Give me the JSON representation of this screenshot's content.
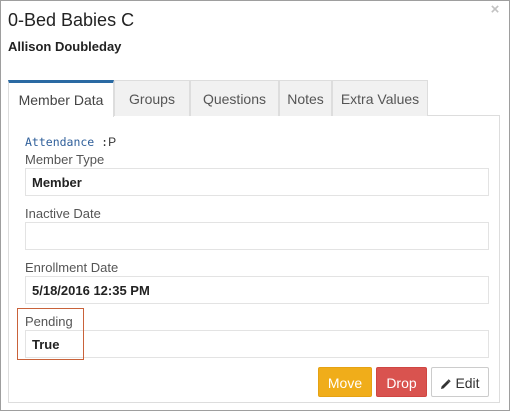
{
  "dialog": {
    "title": "0-Bed Babies C",
    "subtitle": "Allison Doubleday",
    "close_glyph": "×"
  },
  "tabs": [
    {
      "label": "Member Data",
      "active": true
    },
    {
      "label": "Groups",
      "active": false
    },
    {
      "label": "Questions",
      "active": false
    },
    {
      "label": "Notes",
      "active": false
    },
    {
      "label": "Extra Values",
      "active": false
    }
  ],
  "attendance": {
    "key": "Attendance",
    "separator": " :",
    "value": "P"
  },
  "fields": {
    "member_type": {
      "label": "Member Type",
      "value": "Member"
    },
    "inactive_date": {
      "label": "Inactive Date",
      "value": ""
    },
    "enrollment_date": {
      "label": "Enrollment Date",
      "value": "5/18/2016 12:35 PM"
    },
    "pending": {
      "label": "Pending",
      "value": "True"
    }
  },
  "buttons": {
    "move": "Move",
    "drop": "Drop",
    "edit": "Edit"
  },
  "colors": {
    "tab_accent": "#2a6aa3",
    "move": "#f0ad1a",
    "drop": "#d9534f",
    "highlight_box": "#c9623a",
    "attendance_key": "#2f5f9a"
  },
  "icons": {
    "close": "close-icon",
    "edit": "pencil-icon"
  }
}
